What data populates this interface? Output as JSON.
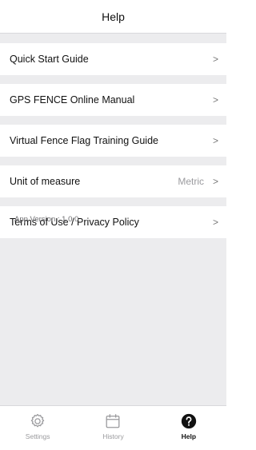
{
  "header": {
    "title": "Help"
  },
  "menu": {
    "items": [
      {
        "label": "Quick Start Guide",
        "value": "",
        "chevron": ">"
      },
      {
        "label": "GPS FENCE Online Manual",
        "value": "",
        "chevron": ">"
      },
      {
        "label": "Virtual Fence Flag Training Guide",
        "value": "",
        "chevron": ">"
      },
      {
        "label": "Unit of measure",
        "value": "Metric",
        "chevron": ">"
      },
      {
        "label": "Terms of Use / Privacy Policy",
        "value": "",
        "chevron": ">"
      }
    ]
  },
  "app_version": "App Version : 1.0.0",
  "tabbar": {
    "tabs": [
      {
        "label": "Settings",
        "icon": "gear-icon",
        "active": false
      },
      {
        "label": "History",
        "icon": "calendar-icon",
        "active": false
      },
      {
        "label": "Help",
        "icon": "question-circle-icon",
        "active": true
      }
    ],
    "colors": {
      "inactive": "#9a9a9d",
      "active": "#111111"
    }
  }
}
